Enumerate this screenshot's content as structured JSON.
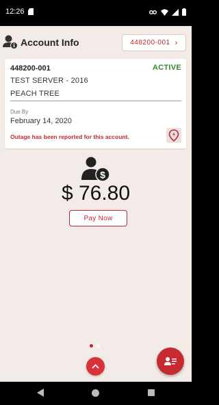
{
  "status_bar": {
    "time": "12:26"
  },
  "header": {
    "title": "Account Info",
    "account_selector": "448200-001",
    "chevron": "›"
  },
  "account_card": {
    "account_number": "448200-001",
    "status": "ACTIVE",
    "server": "TEST SERVER - 2016",
    "location": "PEACH TREE",
    "due_label": "Due By",
    "due_date": "February 14, 2020",
    "outage_message": "Outage has been reported for this account."
  },
  "bill": {
    "amount": "$ 76.80",
    "pay_button": "Pay Now"
  },
  "pager": {
    "pages": 2,
    "current": 1
  },
  "icons": {
    "header": "account-info-icon",
    "outage": "outage-map-pin-icon",
    "bill": "user-dollar-icon",
    "up_fab": "chevron-up-icon",
    "contact_fab": "contact-card-icon"
  },
  "colors": {
    "accent": "#c0282d",
    "status_active": "#2e8b2e",
    "background": "#f2ebe8"
  }
}
